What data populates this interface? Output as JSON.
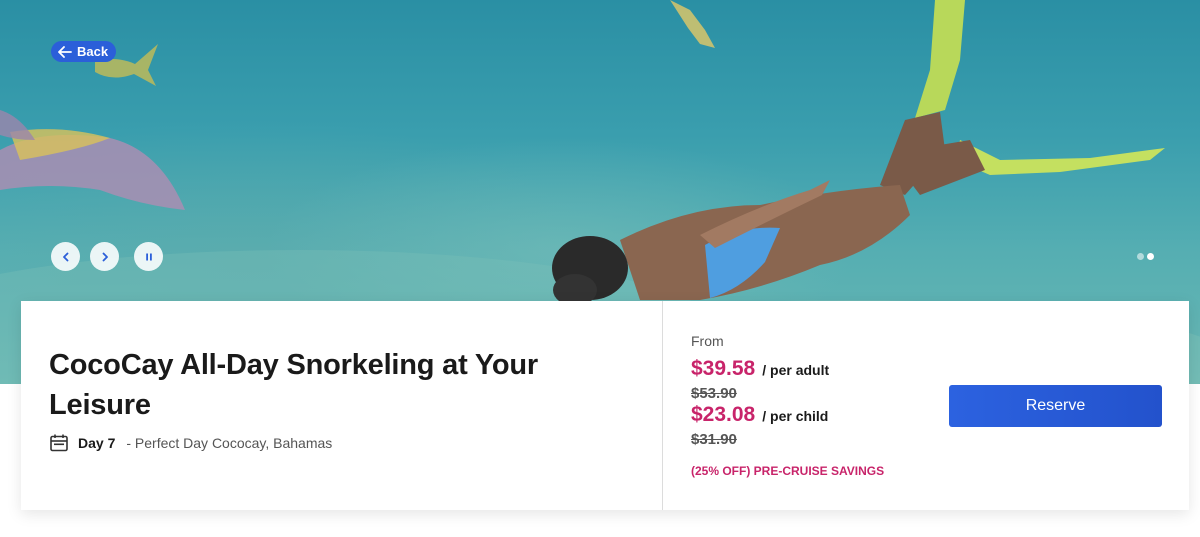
{
  "hero": {
    "back_label": "Back",
    "prev_icon": "chevron-left-icon",
    "next_icon": "chevron-right-icon",
    "pause_icon": "pause-icon",
    "slides_count": 2,
    "active_slide": 2
  },
  "activity": {
    "title": "CocoCay All-Day Snorkeling at Your Leisure",
    "day_label": "Day 7",
    "location": "- Perfect Day Cococay, Bahamas",
    "calendar_icon": "calendar-icon"
  },
  "pricing": {
    "from_label": "From",
    "adult_price": "$39.58",
    "adult_unit": "/ per adult",
    "adult_old_price": "$53.90",
    "child_price": "$23.08",
    "child_unit": "/ per child",
    "child_old_price": "$31.90",
    "savings": "(25% OFF) PRE-CRUISE SAVINGS",
    "reserve_label": "Reserve"
  },
  "colors": {
    "accent_blue": "#2b5fd9",
    "price_pink": "#c8246a"
  }
}
